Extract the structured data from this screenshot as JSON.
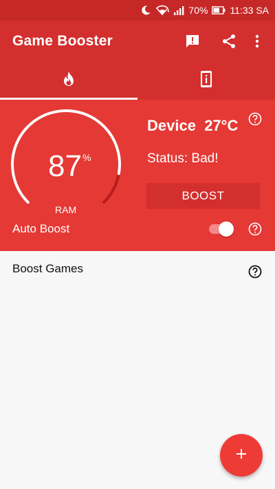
{
  "status_bar": {
    "battery": "70%",
    "time": "11:33 SA",
    "icons": [
      "moon-icon",
      "wifi-icon",
      "signal-icon",
      "battery-icon"
    ]
  },
  "app_bar": {
    "title": "Game Booster",
    "actions": [
      "feedback-icon",
      "share-icon",
      "more-vert-icon"
    ]
  },
  "tabs": [
    {
      "icon": "flame-icon",
      "active": true
    },
    {
      "icon": "phone-info-icon",
      "active": false
    }
  ],
  "ram": {
    "value": "87",
    "unit": "%",
    "label": "RAM",
    "percent": 87
  },
  "device": {
    "label": "Device",
    "temperature": "27°C",
    "status": "Status: Bad!",
    "boost_label": "BOOST"
  },
  "auto_boost": {
    "label": "Auto Boost",
    "enabled": true
  },
  "boost_games": {
    "title": "Boost Games"
  },
  "fab": {
    "icon": "plus-icon",
    "label": "+"
  },
  "colors": {
    "status_bar": "#c62828",
    "app_bar": "#d32f2f",
    "hero": "#e53935",
    "accent": "#ef3b36",
    "background": "#f7f7f7"
  }
}
